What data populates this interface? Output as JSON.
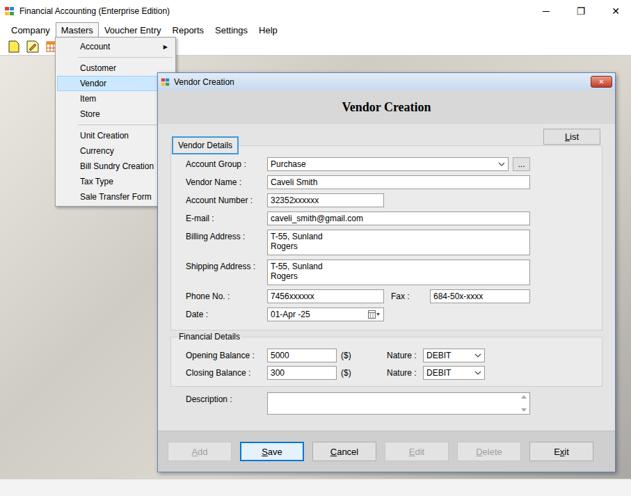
{
  "window": {
    "title": "Financial Accounting (Enterprise Edition)",
    "controls": [
      "─",
      "❐",
      "✕"
    ]
  },
  "menu_bar": [
    {
      "label": "Company",
      "selected": false
    },
    {
      "label": "Masters",
      "selected": true
    },
    {
      "label": "Voucher Entry",
      "selected": false
    },
    {
      "label": "Reports",
      "selected": false
    },
    {
      "label": "Settings",
      "selected": false
    },
    {
      "label": "Help",
      "selected": false
    }
  ],
  "masters_menu": [
    {
      "kind": "item",
      "label": "Account",
      "arrow": "▶",
      "selected": false
    },
    {
      "kind": "separator"
    },
    {
      "kind": "item",
      "label": "Customer",
      "selected": false
    },
    {
      "kind": "item",
      "label": "Vendor",
      "selected": true
    },
    {
      "kind": "item",
      "label": "Item",
      "selected": false
    },
    {
      "kind": "item",
      "label": "Store",
      "selected": false
    },
    {
      "kind": "separator"
    },
    {
      "kind": "item",
      "label": "Unit Creation",
      "selected": false
    },
    {
      "kind": "item",
      "label": "Currency",
      "selected": false
    },
    {
      "kind": "item",
      "label": "Bill Sundry Creation",
      "selected": false
    },
    {
      "kind": "item",
      "label": "Tax Type",
      "selected": false
    },
    {
      "kind": "item",
      "label": "Sale Transfer Form",
      "selected": false
    }
  ],
  "dialog": {
    "title": "Vendor Creation",
    "close": "✕",
    "heading": "Vendor Creation",
    "list_button": {
      "label": "List",
      "underline": 0
    },
    "section": "Vendor Details",
    "fields": [
      {
        "kind": "select",
        "label": "Account Group :",
        "value": "Purchase",
        "extra": "..."
      },
      {
        "kind": "text",
        "label": "Vendor Name :",
        "value": "Caveli Smith"
      },
      {
        "kind": "short",
        "label": "Account Number :",
        "value": "32352xxxxxx"
      },
      {
        "kind": "text",
        "label": "E-mail :",
        "value": "caveli_smith@gmail.com"
      },
      {
        "kind": "textarea",
        "label": "Billing Address :",
        "value": "T-55, Sunland\nRogers"
      },
      {
        "kind": "textarea",
        "label": "Shipping Address :",
        "value": "T-55, Sunland\nRogers"
      },
      {
        "kind": "pair",
        "label": "Phone No. :",
        "value": "7456xxxxxx",
        "second_label": "Fax :",
        "second_value": "684-50x-xxxx"
      },
      {
        "kind": "date",
        "label": "Date :",
        "value": "01-Apr -25"
      }
    ],
    "financial": {
      "title": "Financial Details",
      "rows": [
        {
          "label": "Opening Balance :",
          "value": "5000",
          "unit": "($)",
          "nature_label": "Nature :",
          "nature": "DEBIT"
        },
        {
          "label": "Closing Balance :",
          "value": "300",
          "unit": "($)",
          "nature_label": "Nature :",
          "nature": "DEBIT"
        }
      ]
    },
    "description": {
      "label": "Description :",
      "value": ""
    },
    "buttons": [
      {
        "label": "Add",
        "underline": 0,
        "disabled": true,
        "focused": false
      },
      {
        "label": "Save",
        "underline": 0,
        "disabled": false,
        "focused": true
      },
      {
        "label": "Cancel",
        "underline": 0,
        "disabled": false,
        "focused": false
      },
      {
        "label": "Edit",
        "underline": 0,
        "disabled": true,
        "focused": false
      },
      {
        "label": "Delete",
        "underline": 0,
        "disabled": true,
        "focused": false
      },
      {
        "label": "Exit",
        "underline": 1,
        "disabled": false,
        "focused": false
      }
    ]
  }
}
